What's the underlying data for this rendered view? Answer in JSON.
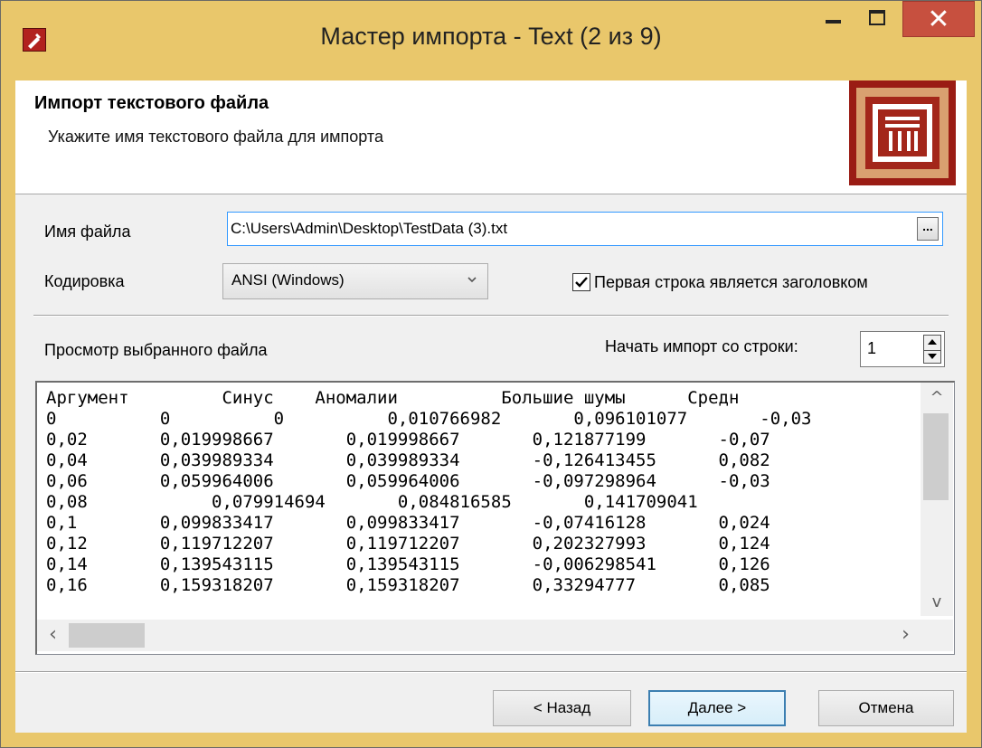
{
  "window": {
    "title": "Мастер импорта - Text (2 из 9)",
    "close_glyph": "✕"
  },
  "header": {
    "title": "Импорт текстового файла",
    "subtitle": "Укажите имя текстового файла для импорта"
  },
  "file": {
    "label": "Имя файла",
    "value": "C:\\Users\\Admin\\Desktop\\TestData (3).txt",
    "browse_label": "..."
  },
  "encoding": {
    "label": "Кодировка",
    "value": "ANSI (Windows)"
  },
  "first_row_header": {
    "label": "Первая строка является заголовком",
    "checked": true
  },
  "preview": {
    "label": "Просмотр выбранного файла",
    "start_label": "Начать импорт со строки:",
    "start_value": "1",
    "lines": [
      "Аргумент         Синус    Аномалии          Большие шумы      Средн",
      "0          0          0          0,010766982       0,096101077       -0,03",
      "0,02       0,019998667       0,019998667       0,121877199       -0,07",
      "0,04       0,039989334       0,039989334       -0,126413455      0,082",
      "0,06       0,059964006       0,059964006       -0,097298964      -0,03",
      "0,08            0,079914694       0,084816585       0,141709041",
      "0,1        0,099833417       0,099833417       -0,07416128       0,024",
      "0,12       0,119712207       0,119712207       0,202327993       0,124",
      "0,14       0,139543115       0,139543115       -0,006298541      0,126",
      "0,16       0,159318207       0,159318207       0,33294777        0,085"
    ]
  },
  "buttons": {
    "back": "< Назад",
    "next": "Далее >",
    "cancel": "Отмена"
  },
  "colors": {
    "frame": "#e9c76b",
    "close": "#c7503f",
    "logo": "#9a1c14"
  }
}
